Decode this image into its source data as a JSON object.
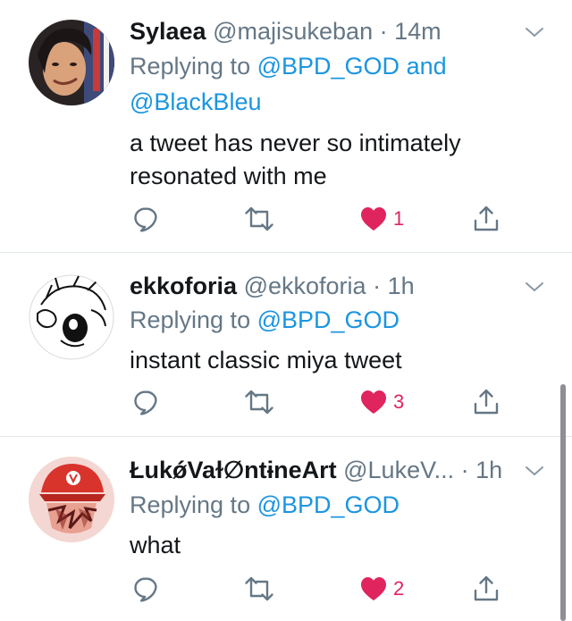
{
  "colors": {
    "text": "#14171a",
    "secondary": "#657786",
    "link": "#1b95e0",
    "like": "#e0245e",
    "icon": "#657786",
    "divider": "#e1e8ed"
  },
  "tweets": [
    {
      "name": "Sylaea",
      "handle": "@majisukeban",
      "dot": "·",
      "time": "14m",
      "replying_prefix": "Replying to",
      "reply_to_1": "@BPD_GOD",
      "reply_joiner": "and",
      "reply_to_2": "@BlackBleu",
      "text": "a tweet has never so intimately resonated with me",
      "like_count": "1",
      "liked": true,
      "icons": [
        "reply-icon",
        "retweet-icon",
        "heart-icon",
        "share-icon",
        "chevron-down-icon"
      ]
    },
    {
      "name": "ekkoforia",
      "handle": "@ekkoforia",
      "dot": "·",
      "time": "1h",
      "replying_prefix": "Replying to",
      "reply_to_1": "@BPD_GOD",
      "text": "instant classic miya tweet",
      "like_count": "3",
      "liked": true,
      "icons": [
        "reply-icon",
        "retweet-icon",
        "heart-icon",
        "share-icon",
        "chevron-down-icon"
      ]
    },
    {
      "name": "ŁukǿVaɫ∅ntɨneArt",
      "handle": "@LukeV...",
      "dot": "·",
      "time": "1h",
      "replying_prefix": "Replying to",
      "reply_to_1": "@BPD_GOD",
      "text": "what",
      "like_count": "2",
      "liked": true,
      "icons": [
        "reply-icon",
        "retweet-icon",
        "heart-icon",
        "share-icon",
        "chevron-down-icon"
      ]
    }
  ]
}
